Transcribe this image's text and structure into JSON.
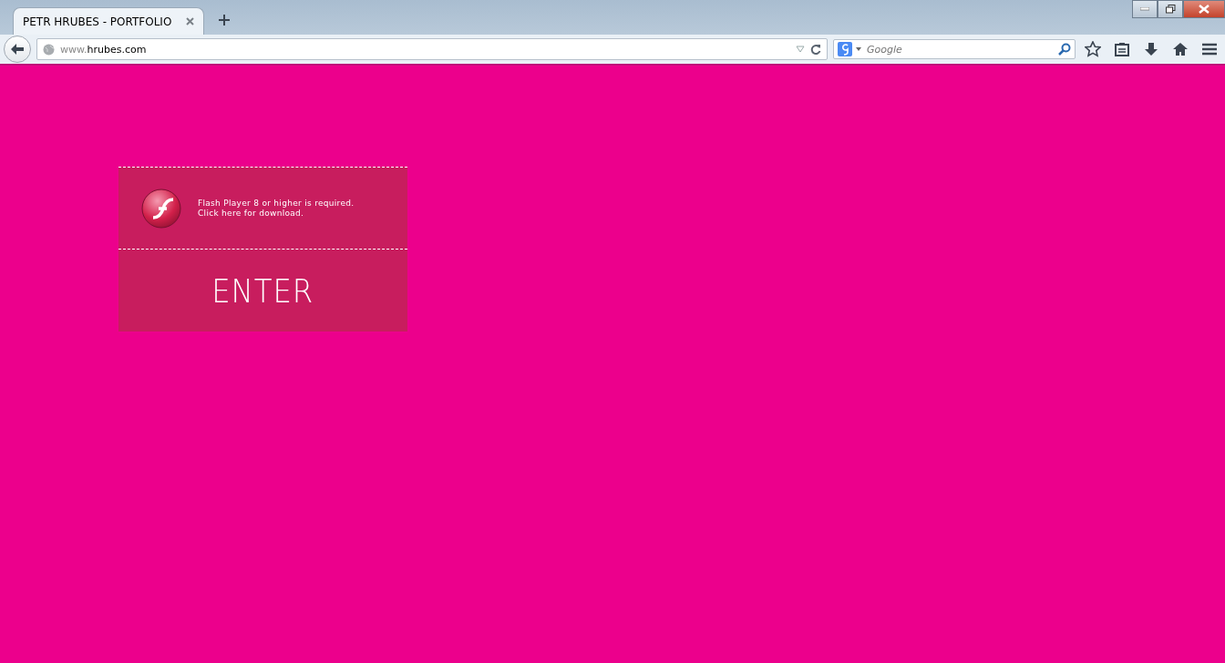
{
  "tabs": [
    {
      "title": "PETR HRUBES - PORTFOLIO",
      "selected": true
    }
  ],
  "address_bar": {
    "prefix": "www.",
    "domain": "hrubes.com"
  },
  "search": {
    "placeholder": "Google"
  },
  "flash_notice": {
    "lines": [
      "Flash Player 8 or higher is required.",
      "Click here for download."
    ]
  },
  "enter_button": "ENTER"
}
